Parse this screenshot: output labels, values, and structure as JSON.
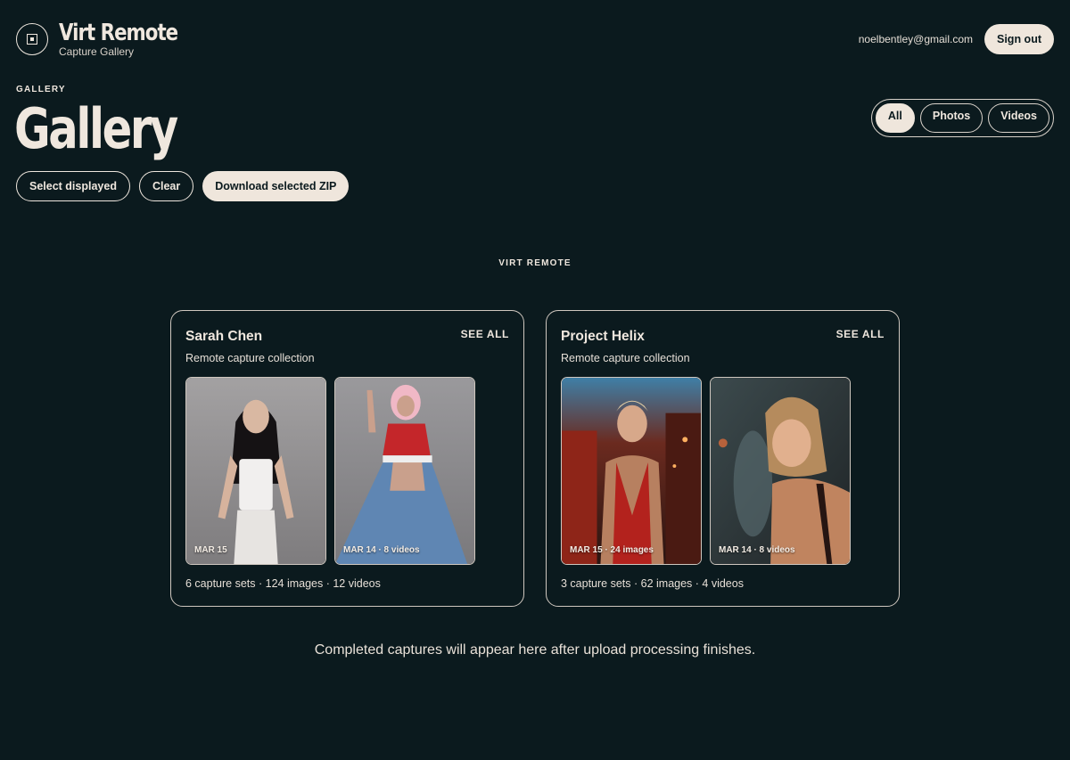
{
  "app": {
    "title": "Virt Remote",
    "subtitle": "Capture Gallery",
    "logo_icon": "target-square-icon"
  },
  "user": {
    "email": "noelbentley@gmail.com",
    "sign_out_label": "Sign out"
  },
  "page": {
    "eyebrow": "GALLERY",
    "title": "Gallery"
  },
  "filters": [
    {
      "label": "All",
      "active": true
    },
    {
      "label": "Photos",
      "active": false
    },
    {
      "label": "Videos",
      "active": false
    }
  ],
  "actions": {
    "select_displayed": "Select displayed",
    "clear": "Clear",
    "download_zip": "Download selected ZIP"
  },
  "section": {
    "label": "VIRT REMOTE"
  },
  "collections": [
    {
      "name": "Sarah Chen",
      "see_all": "SEE ALL",
      "description": "Remote capture collection",
      "thumbs": [
        {
          "label": "MAR 15",
          "tone": "#8f8c8c"
        },
        {
          "label": "MAR 14 · 8 videos",
          "tone": "#8b8a8d"
        }
      ],
      "stats": "6 capture sets · 124 images · 12 videos"
    },
    {
      "name": "Project Helix",
      "see_all": "SEE ALL",
      "description": "Remote capture collection",
      "thumbs": [
        {
          "label": "MAR 15 · 24 images",
          "tone": "#5a2d22"
        },
        {
          "label": "MAR 14 · 8 videos",
          "tone": "#3a4446"
        }
      ],
      "stats": "3 capture sets · 62 images · 4 videos"
    }
  ],
  "empty_note": "Completed captures will appear here after upload processing finishes.",
  "colors": {
    "background": "#0b1a1e",
    "text": "#efe7de",
    "accent": "#efe6dc"
  }
}
